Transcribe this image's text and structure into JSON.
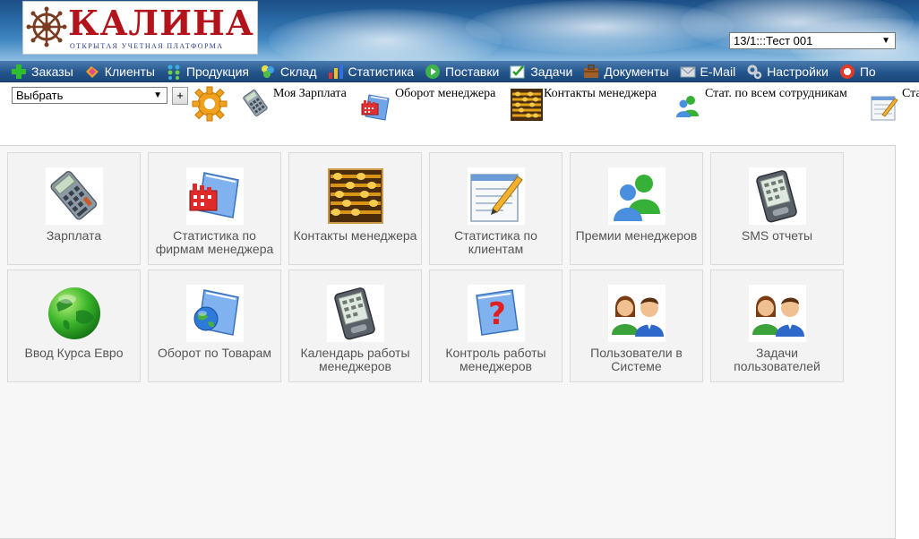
{
  "logo": {
    "title": "КАЛИНА",
    "subtitle": "ОТКРЫТАЯ УЧЕТНАЯ ПЛАТФОРМА"
  },
  "project_select": {
    "value": "13/1:::Тест 001"
  },
  "menu": {
    "items": [
      {
        "label": "Заказы",
        "icon": "plus-icon"
      },
      {
        "label": "Клиенты",
        "icon": "clients-icon"
      },
      {
        "label": "Продукция",
        "icon": "products-icon"
      },
      {
        "label": "Склад",
        "icon": "warehouse-icon"
      },
      {
        "label": "Статистика",
        "icon": "statistics-icon"
      },
      {
        "label": "Поставки",
        "icon": "deliveries-icon"
      },
      {
        "label": "Задачи",
        "icon": "tasks-icon"
      },
      {
        "label": "Документы",
        "icon": "documents-icon"
      },
      {
        "label": "E-Mail",
        "icon": "email-icon"
      },
      {
        "label": "Настройки",
        "icon": "settings-icon"
      },
      {
        "label": "По",
        "icon": "help-icon"
      }
    ]
  },
  "toolbar": {
    "choose_value": "Выбрать",
    "add_label": "+",
    "quick_links": [
      {
        "label": "Моя Зарплата",
        "icon": "calculator-icon"
      },
      {
        "label": "Оборот менеджера",
        "icon": "folder-chart-icon"
      },
      {
        "label": "Контакты менеджера",
        "icon": "abacus-icon"
      },
      {
        "label": "Стат. по всем сотрудникам",
        "icon": "users-icon"
      },
      {
        "label": "Ста",
        "icon": "notepad-icon"
      }
    ]
  },
  "tiles": [
    {
      "label": "Зарплата",
      "icon": "calculator-icon"
    },
    {
      "label": "Статистика по фирмам менеджера",
      "icon": "folder-chart-icon"
    },
    {
      "label": "Контакты менеджера",
      "icon": "abacus-icon"
    },
    {
      "label": "Статистика по клиентам",
      "icon": "notepad-icon"
    },
    {
      "label": "Премии менеджеров",
      "icon": "users-icon"
    },
    {
      "label": "SMS отчеты",
      "icon": "pda-icon"
    },
    {
      "label": "Ввод Курса Евро",
      "icon": "globe-icon"
    },
    {
      "label": "Оборот по Товарам",
      "icon": "folder-globe-icon"
    },
    {
      "label": "Календарь работы менеджеров",
      "icon": "pda-icon"
    },
    {
      "label": "Контроль работы менеджеров",
      "icon": "folder-question-icon"
    },
    {
      "label": "Пользователи в Системе",
      "icon": "people-icon"
    },
    {
      "label": "Задачи пользователей",
      "icon": "people-icon"
    }
  ],
  "colors": {
    "menubar": "#24558d",
    "logo_red": "#b3141b",
    "tile_bg": "#f3f3f3",
    "tile_text": "#555555"
  }
}
